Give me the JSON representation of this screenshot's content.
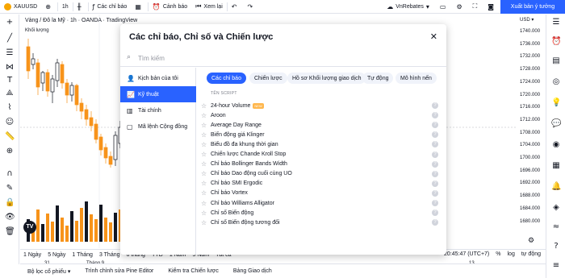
{
  "topbar": {
    "symbol": "XAUUSD",
    "interval": "1h",
    "indicators_label": "Các chỉ báo",
    "alerts_label": "Cảnh báo",
    "replay_label": "Xem lại",
    "broker_label": "VnRebates",
    "publish_label": "Xuất bản ý tưởng"
  },
  "chart": {
    "title": "Vàng / Đô la Mỹ · 1h · OANDA · TradingView",
    "volume_label": "Khối lượng",
    "currency": "USD",
    "price_labels": [
      "1740.000",
      "1736.000",
      "1732.000",
      "1728.000",
      "1724.000",
      "1720.000",
      "1716.000",
      "1712.000",
      "1708.000",
      "1704.000",
      "1700.000",
      "1696.000",
      "1692.000",
      "1688.000",
      "1684.000",
      "1680.000"
    ],
    "time_labels": [
      "31",
      "Tháng 9",
      "13"
    ]
  },
  "range_bar": {
    "items": [
      "1 Ngày",
      "5 Ngày",
      "1 Tháng",
      "3 Tháng",
      "6 tháng",
      "YTD",
      "1 Năm",
      "5 Năm",
      "Tất cả"
    ],
    "clock": "20:45:47 (UTC+7)",
    "percent": "%",
    "log": "log",
    "auto": "tự động"
  },
  "bottom_tabs": [
    "Bộ lọc cổ phiếu",
    "Trình chỉnh sửa Pine Editor",
    "Kiểm tra Chiến lược",
    "Bảng Giao dịch"
  ],
  "modal": {
    "title": "Các chỉ báo, Chỉ số và Chiến lược",
    "search_placeholder": "Tìm kiếm",
    "sidebar": [
      {
        "label": "Kịch bản của tôi",
        "icon": "user-icon",
        "active": false
      },
      {
        "label": "Kỹ thuật",
        "icon": "chart-icon",
        "active": true
      },
      {
        "label": "Tài chính",
        "icon": "finance-icon",
        "active": false
      },
      {
        "label": "Mã lệnh Cộng đồng",
        "icon": "community-icon",
        "active": false
      }
    ],
    "chips": [
      "Các chỉ báo",
      "Chiến lược",
      "Hồ sơ Khối lượng giao dịch",
      "Tự động",
      "Mô hình nến"
    ],
    "list_header": "TÊN SCRIPT",
    "scripts": [
      {
        "name": "24-hour Volume",
        "badge": "NEW"
      },
      {
        "name": "Aroon"
      },
      {
        "name": "Average Day Range"
      },
      {
        "name": "Biến động giá Klinger"
      },
      {
        "name": "Biểu đồ đa khung thời gian"
      },
      {
        "name": "Chiến lược Chande Kroll Stop"
      },
      {
        "name": "Chỉ báo Bollinger Bands Width"
      },
      {
        "name": "Chỉ báo Dao động cuối cùng UO"
      },
      {
        "name": "Chỉ báo SMI Ergodic"
      },
      {
        "name": "Chỉ báo Vortex"
      },
      {
        "name": "Chỉ báo Williams Alligator"
      },
      {
        "name": "Chỉ số Biến động"
      },
      {
        "name": "Chỉ số Biến động tương đối"
      }
    ]
  },
  "colors": {
    "accent": "#2962ff",
    "up": "#131722",
    "down": "#f7931a"
  }
}
